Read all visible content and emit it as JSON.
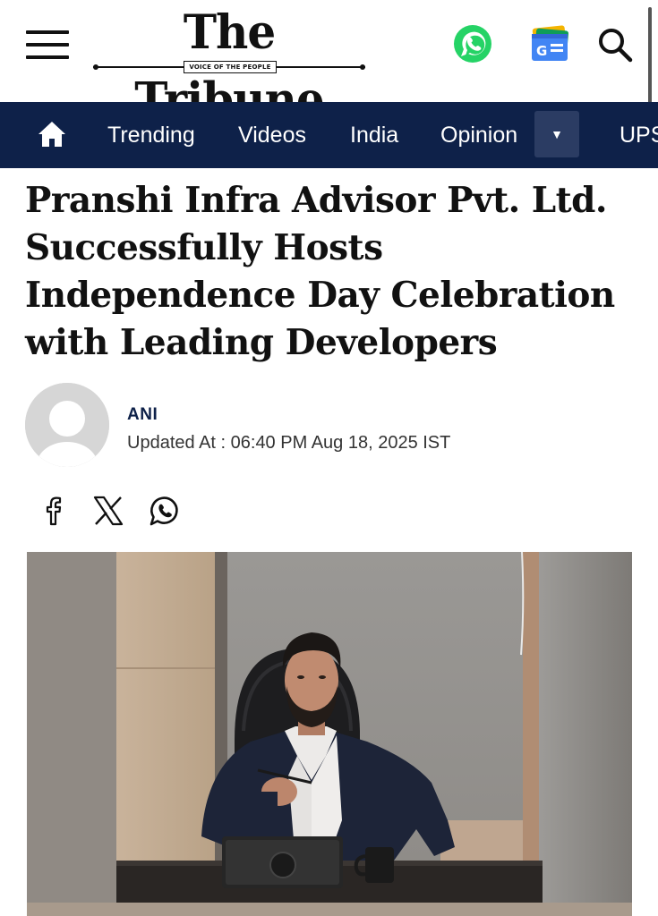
{
  "header": {
    "logo_text": "The Tribune",
    "tagline": "VOICE OF THE PEOPLE"
  },
  "icons": {
    "menu": "hamburger-menu-icon",
    "whatsapp": "whatsapp-icon",
    "google_news": "google-news-icon",
    "search": "search-icon",
    "home": "home-icon",
    "dropdown": "caret-down-icon",
    "facebook": "facebook-icon",
    "x": "x-icon",
    "whatsapp_share": "whatsapp-icon"
  },
  "colors": {
    "nav_bg": "#0e2149",
    "whatsapp_green": "#25d366",
    "author": "#0e2149"
  },
  "nav": {
    "items": [
      "Trending",
      "Videos",
      "India",
      "Opinion"
    ],
    "dropdown_glyph": "▼",
    "overflow_item": "UPSC"
  },
  "article": {
    "headline": "Pranshi Infra Advisor Pvt. Ltd. Successfully Hosts Independence Day Celebration with Leading Developers",
    "author": "ANI",
    "updated": "Updated At : 06:40 PM Aug 18, 2025 IST"
  }
}
